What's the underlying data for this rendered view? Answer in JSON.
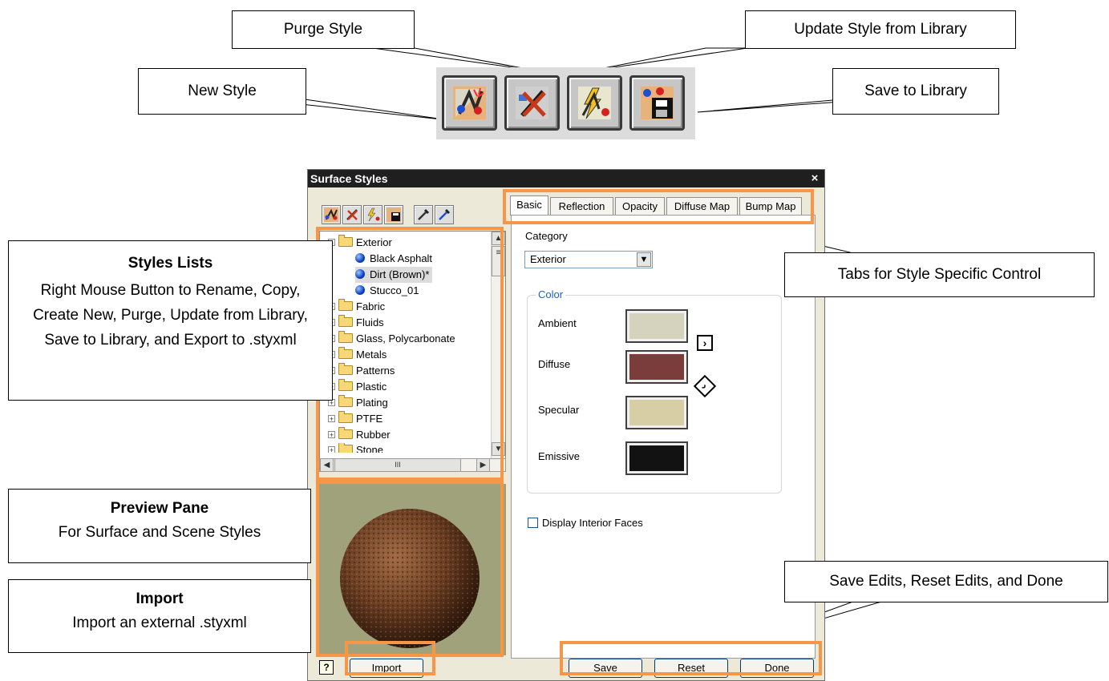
{
  "callouts": {
    "purge_style": "Purge Style",
    "update_style": "Update Style from Library",
    "new_style": "New Style",
    "save_to_library": "Save to Library",
    "styles_lists": {
      "heading": "Styles Lists",
      "body": "Right Mouse Button to Rename, Copy, Create New, Purge, Update from Library, Save to Library, and Export to .styxml"
    },
    "tabs_control": "Tabs for Style Specific Control",
    "preview_pane": {
      "heading": "Preview Pane",
      "body": "For Surface and Scene Styles"
    },
    "import": {
      "heading": "Import",
      "body": "Import an external .styxml"
    },
    "save_edits": "Save Edits, Reset Edits, and Done"
  },
  "toolbar_icons": [
    "new-style-icon",
    "purge-style-icon",
    "update-style-icon",
    "save-to-library-icon"
  ],
  "dialog": {
    "title": "Surface Styles",
    "close": "×",
    "tabs": [
      "Basic",
      "Reflection",
      "Opacity",
      "Diffuse Map",
      "Bump Map"
    ],
    "active_tab": "Basic",
    "category_label": "Category",
    "category_value": "Exterior",
    "color_group_title": "Color",
    "color_rows": [
      {
        "label": "Ambient",
        "color": "#d5d3bd"
      },
      {
        "label": "Diffuse",
        "color": "#7b3c3c"
      },
      {
        "label": "Specular",
        "color": "#d8cea5"
      },
      {
        "label": "Emissive",
        "color": "#121212"
      }
    ],
    "checkbox_label": "Display Interior Faces",
    "tree": {
      "expanded_folder": "Exterior",
      "children": [
        "Black Asphalt",
        "Dirt (Brown)*",
        "Stucco_01"
      ],
      "folders": [
        "Fabric",
        "Fluids",
        "Glass, Polycarbonate",
        "Metals",
        "Patterns",
        "Plastic",
        "Plating",
        "PTFE",
        "Rubber",
        "Stone"
      ]
    },
    "buttons": {
      "import": "Import",
      "save": "Save",
      "reset": "Reset",
      "done": "Done",
      "help": "?"
    },
    "scroll_thumb_grip": "III"
  },
  "colors": {
    "highlight": "#f79646",
    "title_bar": "#1f1f1f",
    "preview_bg": "#a0a27c"
  }
}
